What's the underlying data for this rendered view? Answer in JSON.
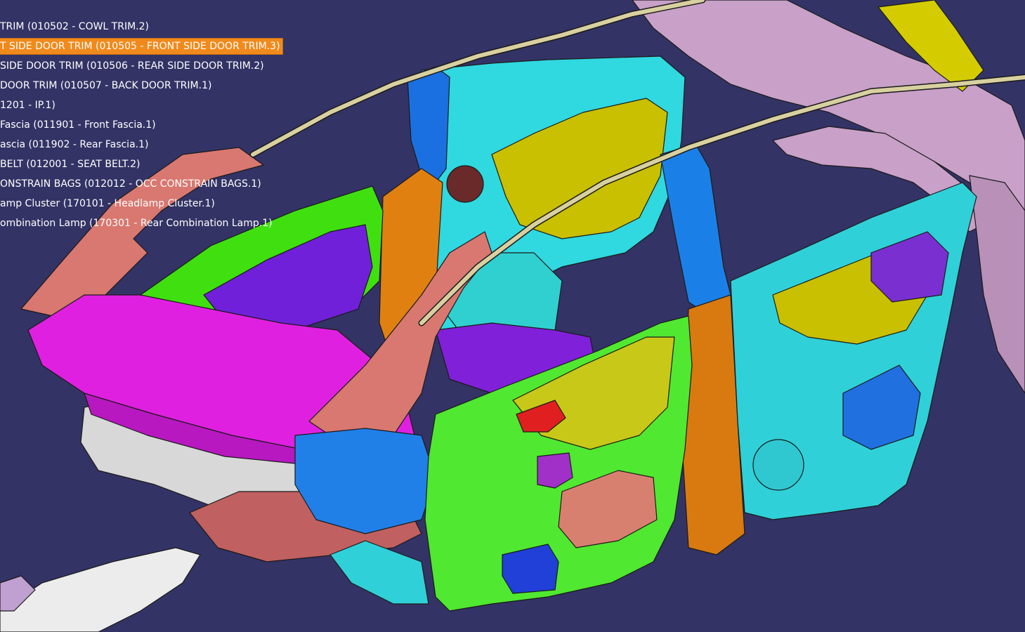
{
  "viewer": {
    "background": "#333366",
    "highlight": "#f08a1c"
  },
  "tree": {
    "items": [
      {
        "label": "TRIM (010502 - COWL TRIM.2)",
        "selected": false
      },
      {
        "label": "T SIDE DOOR TRIM (010505 - FRONT SIDE DOOR TRIM.3)",
        "selected": true
      },
      {
        "label": "SIDE DOOR TRIM (010506 - REAR SIDE DOOR TRIM.2)",
        "selected": false
      },
      {
        "label": "DOOR TRIM (010507 - BACK DOOR TRIM.1)",
        "selected": false
      },
      {
        "label": "1201 - IP.1)",
        "selected": false
      },
      {
        "label": "Fascia (011901 - Front Fascia.1)",
        "selected": false
      },
      {
        "label": "ascia (011902 - Rear Fascia.1)",
        "selected": false
      },
      {
        "label": "BELT (012001 - SEAT BELT.2)",
        "selected": false
      },
      {
        "label": "ONSTRAIN BAGS (012012 - OCC CONSTRAIN BAGS.1)",
        "selected": false
      },
      {
        "label": "amp Cluster (170101 - Headlamp Cluster.1)",
        "selected": false
      },
      {
        "label": "ombination Lamp (170301 - Rear Combination Lamp.1)",
        "selected": false
      }
    ]
  }
}
